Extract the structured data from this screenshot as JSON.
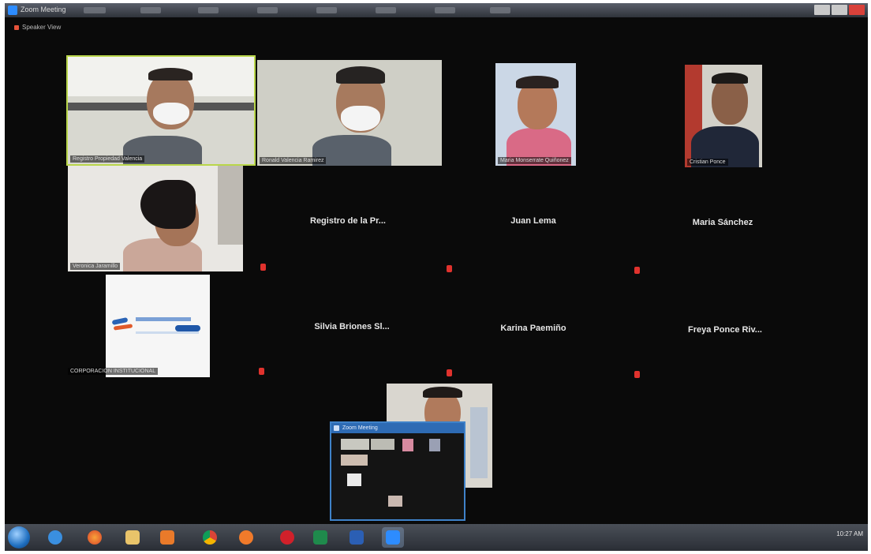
{
  "window": {
    "title": "Zoom Meeting",
    "view_label": "Speaker View"
  },
  "participants_video": [
    {
      "name": "Registro Propiedad Valencia"
    },
    {
      "name": "Ronald Valencia Ramirez"
    },
    {
      "name": "Maria Monserrate Quiñonez"
    },
    {
      "name": "Cristian Ponce"
    },
    {
      "name": "Veronica Jaramillo"
    },
    {
      "name": "CORPORACION INSTITUCIONAL"
    }
  ],
  "participants_audio": [
    {
      "name": "Registro de la Pr..."
    },
    {
      "name": "Juan Lema"
    },
    {
      "name": "Maria Sánchez"
    },
    {
      "name": "Silvia Briones Sl..."
    },
    {
      "name": "Karina Paemiño"
    },
    {
      "name": "Freya Ponce Riv..."
    }
  ],
  "mini_window": {
    "title": "Zoom Meeting"
  },
  "taskbar": {
    "items": [
      "start",
      "internet-explorer",
      "firefox",
      "file-explorer",
      "media-player",
      "chrome",
      "firefox-2",
      "opera",
      "excel",
      "word",
      "zoom"
    ],
    "clock": "10:27 AM"
  },
  "colors": {
    "active_speaker": "#b9d64a",
    "muted": "#e0322d",
    "zoom_blue": "#2d8cff"
  }
}
